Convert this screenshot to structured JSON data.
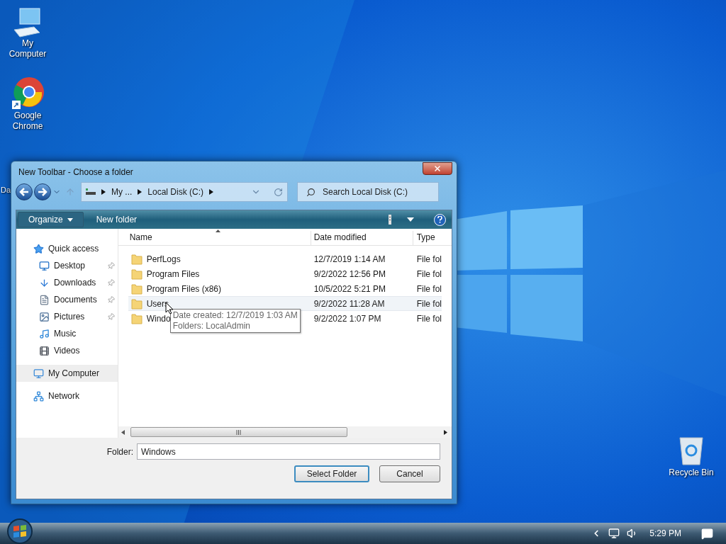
{
  "desktop_icons": [
    {
      "label": "My Computer",
      "kind": "computer"
    },
    {
      "label": "Google Chrome",
      "kind": "chrome"
    },
    {
      "label": "Da",
      "kind": "partial"
    }
  ],
  "dialog": {
    "title": "New Toolbar - Choose a folder",
    "breadcrumb": [
      "My ...",
      "Local Disk (C:)"
    ],
    "search": {
      "placeholder": "Search Local Disk (C:)"
    },
    "toolbar": {
      "organize": "Organize",
      "new_folder": "New folder"
    },
    "sidebar": [
      {
        "label": "Quick access",
        "kind": "star",
        "highlighted": false,
        "children": [
          {
            "label": "Desktop",
            "kind": "desktop",
            "pinned": true
          },
          {
            "label": "Downloads",
            "kind": "download",
            "pinned": true
          },
          {
            "label": "Documents",
            "kind": "document",
            "pinned": true
          },
          {
            "label": "Pictures",
            "kind": "pictures",
            "pinned": true
          },
          {
            "label": "Music",
            "kind": "music",
            "pinned": false
          },
          {
            "label": "Videos",
            "kind": "videos",
            "pinned": false
          }
        ]
      },
      {
        "label": "My Computer",
        "kind": "computer",
        "highlighted": true
      },
      {
        "label": "Network",
        "kind": "network",
        "highlighted": false
      }
    ],
    "columns": [
      "Name",
      "Date modified",
      "Type"
    ],
    "rows": [
      {
        "name": "PerfLogs",
        "date": "12/7/2019 1:14 AM",
        "type": "File fol",
        "hovered": false
      },
      {
        "name": "Program Files",
        "date": "9/2/2022 12:56 PM",
        "type": "File fol",
        "hovered": false
      },
      {
        "name": "Program Files (x86)",
        "date": "10/5/2022 5:21 PM",
        "type": "File fol",
        "hovered": false
      },
      {
        "name": "Users",
        "date": "9/2/2022 11:28 AM",
        "type": "File fol",
        "hovered": true
      },
      {
        "name": "Windo",
        "date": "9/2/2022 1:07 PM",
        "type": "File fol",
        "hovered": false
      }
    ],
    "tooltip": [
      "Date created: 12/7/2019 1:03 AM",
      "Folders: LocalAdmin"
    ],
    "folder_label": "Folder:",
    "folder_value": "Windows",
    "buttons": [
      {
        "label": "Select Folder",
        "default": true
      },
      {
        "label": "Cancel",
        "default": false
      }
    ]
  },
  "recycle_bin": {
    "label": "Recycle Bin"
  },
  "taskbar": {
    "time": "5:29 PM"
  }
}
